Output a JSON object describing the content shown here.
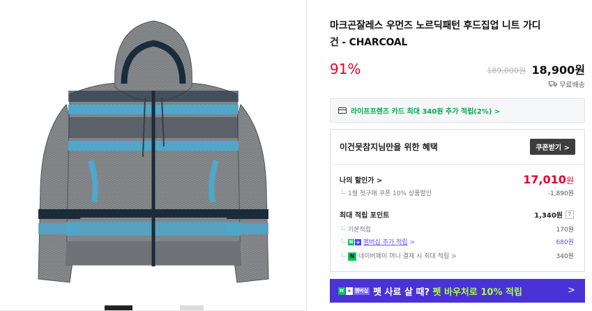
{
  "product": {
    "title_line1": "마크곤잘레스 우먼즈 노르딕패턴 후드집업 니트 가디",
    "title_line2": "건 - CHARCOAL",
    "discount_rate": "91%",
    "original_price": "189,000원",
    "sale_price": "18,900원",
    "shipping": "무료배송"
  },
  "card_banner": {
    "text": "라이프프렌즈 카드 최대 340원 추가 적립(2%) >"
  },
  "benefits": {
    "title": "이건못참지님만을 위한 혜택",
    "coupon_button": "쿠폰받기 >",
    "my_discount_label": "나의 할인가 >",
    "my_discount_price": "17,010",
    "my_discount_unit": "원",
    "first_purchase_label": "1월 첫구매 쿠폰 10% 상품할인",
    "first_purchase_value": "-1,890원",
    "points_label": "최대 적립 포인트",
    "points_value": "1,340원",
    "points_help": "?",
    "basic_points_label": "기본적립",
    "basic_points_value": "170원",
    "membership_label": "멤버십 추가 적립",
    "membership_arrow": ">",
    "membership_value": "680원",
    "npay_label": "네이버페이 머니 결제 시 최대 적립 >",
    "npay_value": "340원"
  },
  "promo": {
    "badge_n": "N",
    "badge_plus": "+",
    "badge_membership": "멤버십",
    "text_part1": "펫 사료 살 때?",
    "text_part2": "펫 바우처로 10% 적립",
    "arrow": ">"
  },
  "colors": {
    "accent_red": "#e4002b",
    "naver_green": "#03c75a",
    "membership_purple": "#4a32d6"
  }
}
